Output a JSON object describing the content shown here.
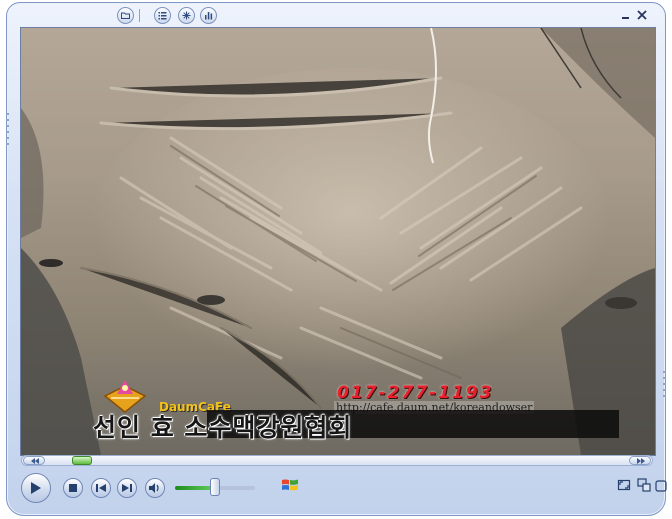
{
  "toolbar": {
    "buttons": [
      {
        "name": "now-playing",
        "icon": "folder-icon"
      },
      {
        "name": "playlist",
        "icon": "list-icon"
      },
      {
        "name": "visualization",
        "icon": "snowflake-icon"
      },
      {
        "name": "equalizer",
        "icon": "bars-icon"
      }
    ]
  },
  "window": {
    "controls": [
      "minimize-icon",
      "close-icon"
    ]
  },
  "video": {
    "overlay": {
      "phone": "017-277-1193",
      "brand": "DaumCaFe",
      "url": "http://cafe.daum.net/koreandowser",
      "title": "선인 효 소수맥강원협회"
    }
  },
  "seek": {
    "position": 0.05
  },
  "controls": {
    "buttons": [
      "play-icon",
      "stop-icon",
      "previous-icon",
      "next-icon",
      "mute-icon"
    ],
    "volume": 0.5,
    "right_buttons": [
      "fullscreen-icon",
      "switch-skin-icon",
      "layout-icon"
    ]
  },
  "colors": {
    "frame": "#c9d7ef",
    "frame_border": "#7f98c5",
    "accent_green": "#5fbd3c",
    "phone_red": "#e8202c"
  }
}
